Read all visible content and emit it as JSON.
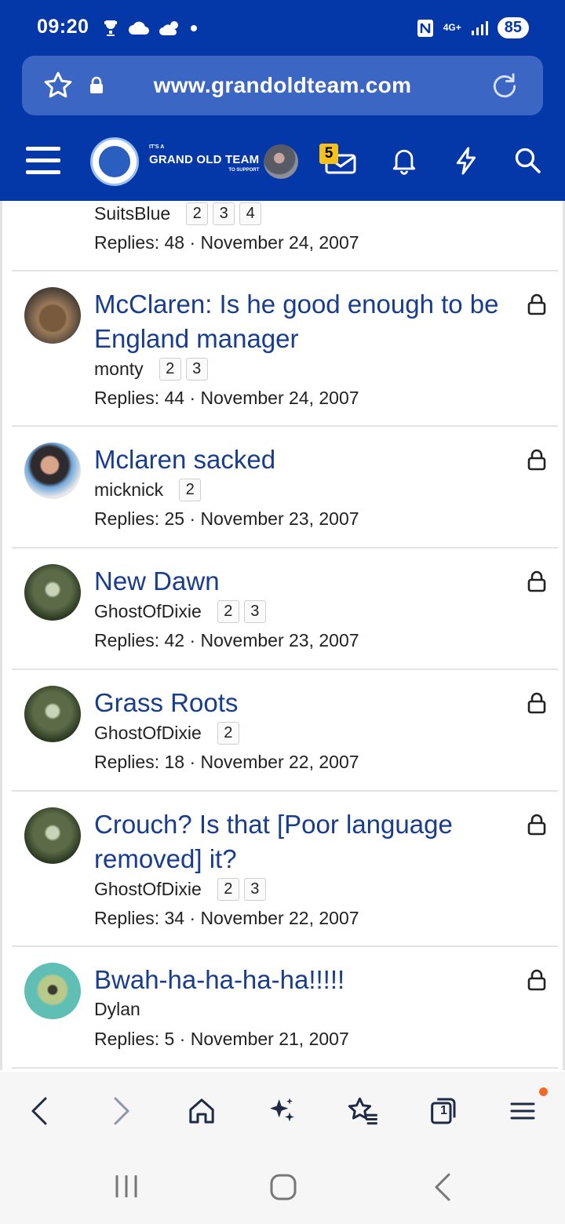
{
  "status_bar": {
    "time": "09:20",
    "network": "4G+",
    "battery": "85"
  },
  "address_bar": {
    "url": "www.grandoldteam.com"
  },
  "site_header": {
    "logo_small": "IT'S A",
    "logo_title": "GRAND OLD TEAM",
    "logo_sub": "TO SUPPORT",
    "inbox_count": "5"
  },
  "threads": [
    {
      "title": "",
      "author": "SuitsBlue",
      "pages": [
        "2",
        "3",
        "4"
      ],
      "meta": "Replies: 48 · November 24, 2007"
    },
    {
      "title": "McClaren: Is he good enough to be England manager",
      "author": "monty",
      "pages": [
        "2",
        "3"
      ],
      "meta": "Replies: 44 · November 24, 2007"
    },
    {
      "title": "Mclaren sacked",
      "author": "micknick",
      "pages": [
        "2"
      ],
      "meta": "Replies: 25 · November 23, 2007"
    },
    {
      "title": "New Dawn",
      "author": "GhostOfDixie",
      "pages": [
        "2",
        "3"
      ],
      "meta": "Replies: 42 · November 23, 2007"
    },
    {
      "title": "Grass Roots",
      "author": "GhostOfDixie",
      "pages": [
        "2"
      ],
      "meta": "Replies: 18 · November 22, 2007"
    },
    {
      "title": "Crouch? Is that [Poor language removed] it?",
      "author": "GhostOfDixie",
      "pages": [
        "2",
        "3"
      ],
      "meta": "Replies: 34 · November 22, 2007"
    },
    {
      "title": "Bwah-ha-ha-ha-ha!!!!!",
      "author": "Dylan",
      "pages": [],
      "meta": "Replies: 5 · November 21, 2007"
    }
  ],
  "bottom_toolbar": {
    "tabs_count": "1"
  },
  "colors": {
    "header_blue": "#0437a8",
    "link_blue": "#183c8e",
    "badge_yellow": "#f6c21a",
    "notification_dot": "#f06a2c"
  }
}
